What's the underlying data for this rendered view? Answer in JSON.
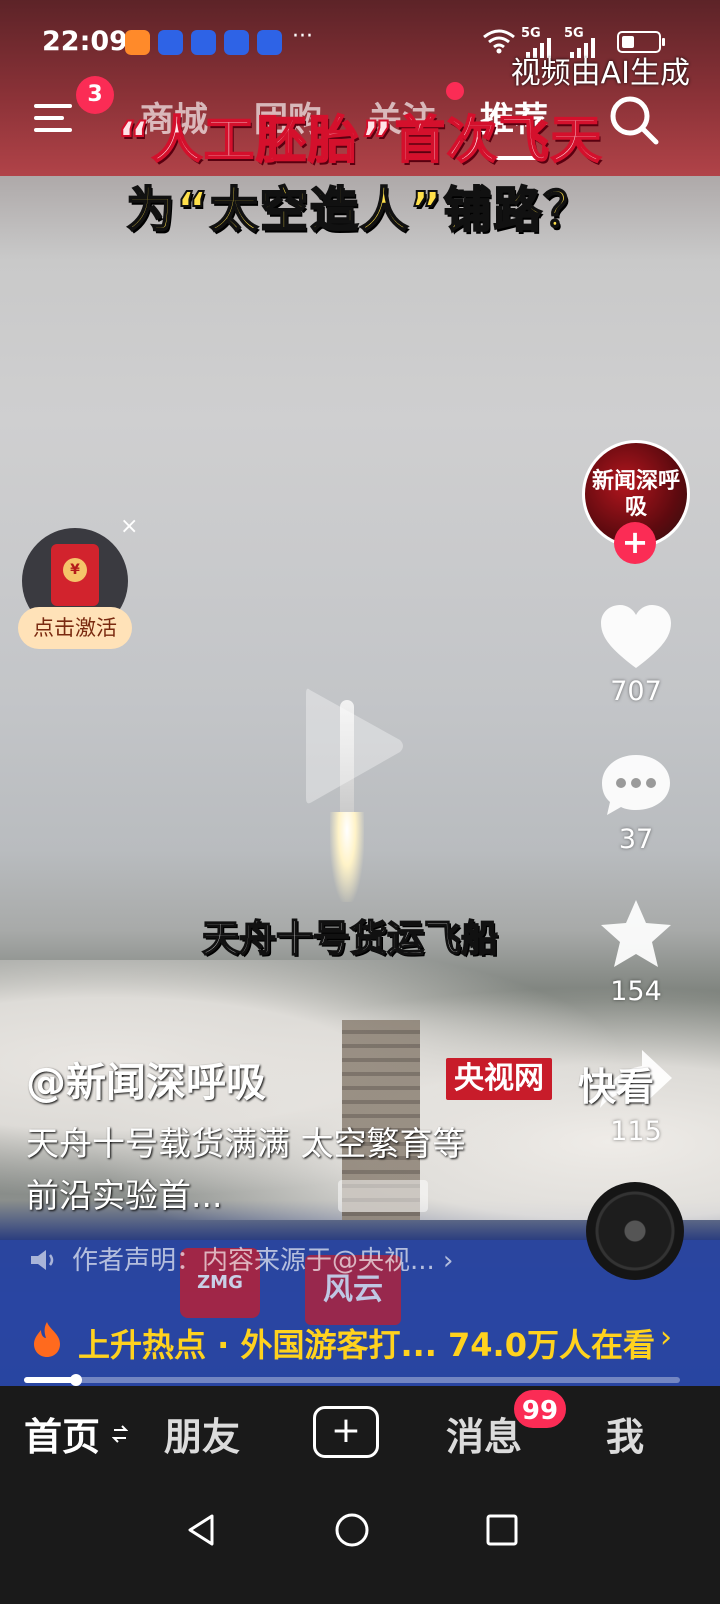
{
  "status_bar": {
    "time": "22:09",
    "more": "···",
    "signal_1": "5G",
    "signal_2": "5G",
    "ai_label": "视频由AI生成"
  },
  "top_nav": {
    "menu_badge": "3",
    "tabs": [
      "商城",
      "团购",
      "关注",
      "推荐"
    ],
    "active_tab": "推荐"
  },
  "video": {
    "headline_line1": "“人工胚胎”首次飞天",
    "headline_line2": "为“太空造人”铺路？",
    "subtitle": "天舟十号货运飞船",
    "brand_logo": "央视网",
    "source_tag": "快看",
    "zmg_label": "ZMG",
    "fengyun_label": "风云"
  },
  "red_packet": {
    "coin": "¥",
    "close": "×",
    "label": "点击激活"
  },
  "right_rail": {
    "avatar_text": "新闻深呼吸",
    "follow": "+",
    "likes": "707",
    "comments": "37",
    "favorites": "154",
    "shares": "115"
  },
  "post": {
    "author": "@新闻深呼吸",
    "description": "天舟十号载货满满 太空繁育等前沿实验首...",
    "statement": "作者声明：内容来源于@央视...  ›"
  },
  "hot": {
    "text": "上升热点 · 外国游客打...",
    "views": "74.0万人在看",
    "arrow": "›"
  },
  "progress": {
    "value": 0.08
  },
  "bottom_tabs": {
    "home": "首页",
    "friends": "朋友",
    "add": "+",
    "messages": "消息",
    "messages_badge": "99",
    "me": "我"
  },
  "colors": {
    "accent": "#fb2c55",
    "hot_yellow": "#ffd21e",
    "headline_yellow": "#ffe04a",
    "brand_red": "#c81c2a"
  }
}
